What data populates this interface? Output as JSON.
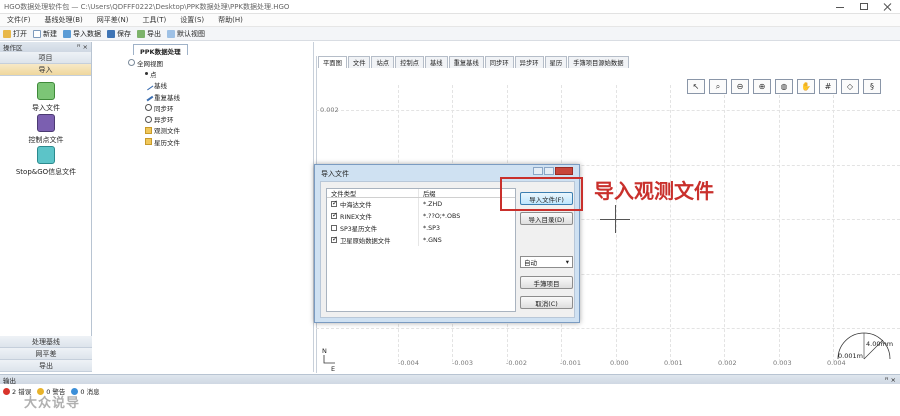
{
  "window": {
    "title": "HGO数据处理软件包 — C:\\Users\\QDFFF0222\\Desktop\\PPK数据处理\\PPK数据处理.HGO"
  },
  "menu": [
    "文件(F)",
    "基线处理(B)",
    "网平差(N)",
    "工具(T)",
    "设置(S)",
    "帮助(H)"
  ],
  "toolbar": {
    "open": "打开",
    "new": "新建",
    "import": "导入数据",
    "save": "保存",
    "export": "导出",
    "default_view": "默认视图"
  },
  "left_panel": {
    "header": "操作区",
    "pin": "ꟸ ×",
    "groups_top": [
      "项目",
      "导入"
    ],
    "actions": [
      "导入文件",
      "控制点文件",
      "Stop&GO信息文件"
    ],
    "groups_bottom": [
      "处理基线",
      "网平差",
      "导出"
    ]
  },
  "doc_tab": "PPK数据处理",
  "tree": {
    "root": "全网视图",
    "children": [
      "点",
      "基线",
      "重复基线",
      "同步环",
      "异步环",
      "观测文件",
      "星历文件"
    ]
  },
  "view_tabs": [
    "平面图",
    "文件",
    "站点",
    "控制点",
    "基线",
    "重复基线",
    "同步环",
    "异步环",
    "星历",
    "手簿项目源始数据"
  ],
  "axis": {
    "y_ticks": [
      "0.002"
    ],
    "x_ticks": [
      "-0.004",
      "-0.003",
      "-0.002",
      "-0.001",
      "0.000",
      "0.001",
      "0.002",
      "0.003",
      "0.004"
    ]
  },
  "compass": {
    "n": "N",
    "e": "E"
  },
  "scale": {
    "length": "4.00mm",
    "value": "0.001m"
  },
  "dialog": {
    "title": "导入文件",
    "col_type": "文件类型",
    "col_ext": "后缀",
    "rows": [
      {
        "checked": true,
        "type": "中海达文件",
        "ext": "*.ZHD"
      },
      {
        "checked": true,
        "type": "RINEX文件",
        "ext": "*.??O;*.OBS"
      },
      {
        "checked": false,
        "type": "SP3星历文件",
        "ext": "*.SP3"
      },
      {
        "checked": true,
        "type": "卫星原始数据文件",
        "ext": "*.GNS"
      }
    ],
    "btn_import_file": "导入文件(F)",
    "btn_import_dir": "导入目录(D)",
    "select_value": "自动",
    "btn_handbook": "手簿项目",
    "btn_cancel": "取消(C)"
  },
  "annotation": "导入观测文件",
  "bottom": {
    "header": "输出",
    "tabs": [
      "2 错误",
      "0 警告",
      "0 消息"
    ]
  },
  "watermark": "大众说导",
  "colors": {
    "accent_red": "#c9302c",
    "dialog_blue": "#cfe1f2"
  }
}
